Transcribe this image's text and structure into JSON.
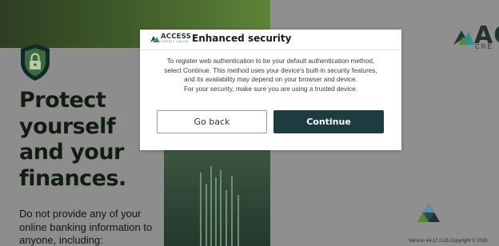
{
  "background": {
    "headline": [
      "Protect",
      "yourself",
      "and your",
      "finances."
    ],
    "subcopy": [
      "Do not provide any of your",
      "online banking information to",
      "anyone, including:"
    ],
    "right_logo": {
      "text": "AC",
      "subtext": "CRE"
    },
    "version": "Version #4.17.0.15 Copyright © 2026"
  },
  "modal": {
    "logo": {
      "text": "ACCESS",
      "subtext": "CREDIT UNION"
    },
    "title": "Enhanced security",
    "body_lines": [
      "To register web authentication to be your default authentication method,",
      "select Continue. This method uses your device's built-in security features,",
      "and its availability may depend on your browser and device.",
      "For your security, make sure you are using a trusted device."
    ],
    "buttons": {
      "back": "Go back",
      "continue": "Continue"
    }
  },
  "colors": {
    "overlay": "#8f8f8f",
    "brand_dark": "#1d3c3f",
    "brand_green": "#5e8338",
    "accent_teal": "#2f8f8a"
  }
}
